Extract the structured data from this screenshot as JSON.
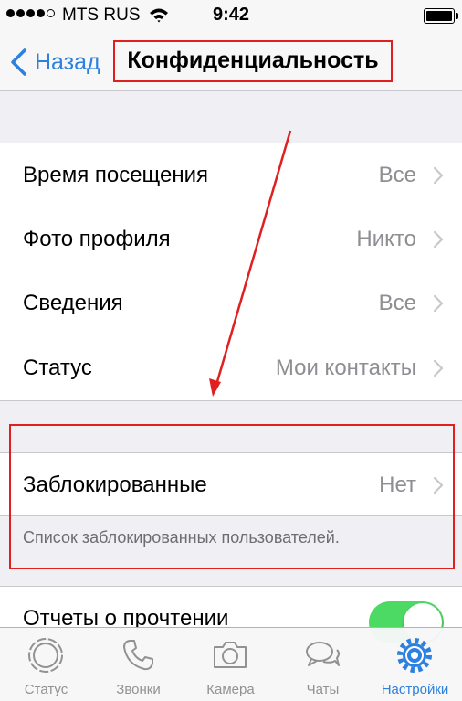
{
  "status_bar": {
    "carrier": "MTS RUS",
    "time": "9:42",
    "signal_bars_filled": 4,
    "signal_bars_total": 5,
    "wifi_icon": "wifi-icon",
    "battery_level": 1.0
  },
  "nav": {
    "back_label": "Назад",
    "title": "Конфиденциальность"
  },
  "privacy_rows": [
    {
      "label": "Время посещения",
      "value": "Все"
    },
    {
      "label": "Фото профиля",
      "value": "Никто"
    },
    {
      "label": "Сведения",
      "value": "Все"
    },
    {
      "label": "Статус",
      "value": "Мои контакты"
    }
  ],
  "blocked": {
    "label": "Заблокированные",
    "value": "Нет",
    "footer": "Список заблокированных пользователей."
  },
  "read_receipts": {
    "label": "Отчеты о прочтении",
    "enabled": true
  },
  "tabs": [
    {
      "label": "Статус",
      "icon": "status-icon",
      "active": false
    },
    {
      "label": "Звонки",
      "icon": "phone-icon",
      "active": false
    },
    {
      "label": "Камера",
      "icon": "camera-icon",
      "active": false
    },
    {
      "label": "Чаты",
      "icon": "chat-bubbles-icon",
      "active": false
    },
    {
      "label": "Настройки",
      "icon": "gear-icon",
      "active": true
    }
  ],
  "colors": {
    "accent": "#2c80e0",
    "highlight": "#e02020",
    "toggle_on": "#4cd964",
    "secondary_text": "#8e8e93",
    "background": "#efeff4"
  }
}
